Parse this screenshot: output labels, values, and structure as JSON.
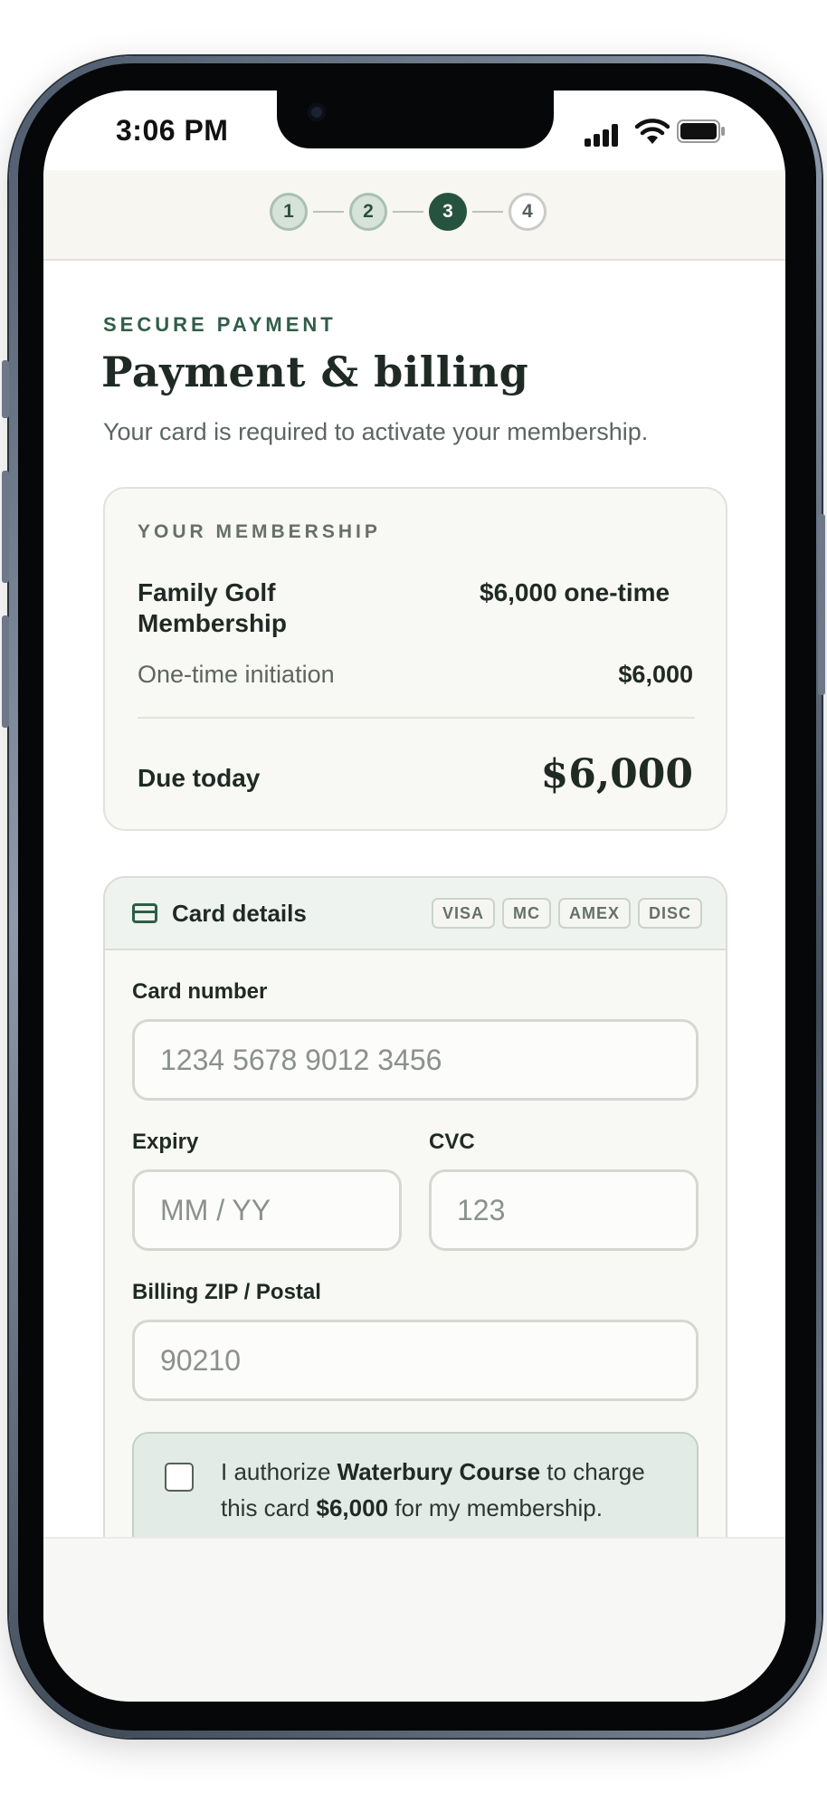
{
  "status_bar": {
    "time": "3:06 PM"
  },
  "stepper": {
    "steps": [
      {
        "label": "1",
        "state": "done"
      },
      {
        "label": "2",
        "state": "done"
      },
      {
        "label": "3",
        "state": "active"
      },
      {
        "label": "4",
        "state": "todo"
      }
    ]
  },
  "header": {
    "eyebrow": "SECURE PAYMENT",
    "title": "Payment & billing",
    "subtitle": "Your card is required to activate your membership."
  },
  "membership": {
    "label": "YOUR MEMBERSHIP",
    "plan_name": "Family Golf Membership",
    "plan_price": "$6,000 one-time",
    "initiation_label": "One-time initiation",
    "initiation_value": "$6,000",
    "due_label": "Due today",
    "due_value": "$6,000"
  },
  "card_details": {
    "title": "Card details",
    "brands": [
      "VISA",
      "MC",
      "AMEX",
      "DISC"
    ],
    "card_number": {
      "label": "Card number",
      "placeholder": "1234 5678 9012 3456",
      "value": ""
    },
    "expiry": {
      "label": "Expiry",
      "placeholder": "MM / YY",
      "value": ""
    },
    "cvc": {
      "label": "CVC",
      "placeholder": "123",
      "value": ""
    },
    "zip": {
      "label": "Billing ZIP / Postal",
      "placeholder": "90210",
      "value": ""
    }
  },
  "authorization": {
    "checked": false,
    "text_prefix": "I authorize ",
    "merchant": "Waterbury Course",
    "text_middle": " to charge this card ",
    "amount": "$6,000",
    "text_suffix": " for my membership."
  },
  "colors": {
    "accent": "#265340",
    "accent_soft": "#d6e3d9",
    "page_background": "#ffffff",
    "panel_background": "#f8f8f4"
  }
}
